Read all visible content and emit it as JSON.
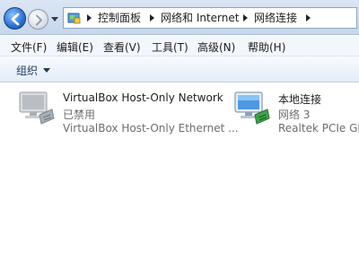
{
  "address_bar": {
    "breadcrumbs": [
      {
        "label": "控制面板"
      },
      {
        "label": "网络和 Internet"
      },
      {
        "label": "网络连接"
      }
    ]
  },
  "menu": {
    "items": [
      {
        "label": "文件(F)"
      },
      {
        "label": "编辑(E)"
      },
      {
        "label": "查看(V)"
      },
      {
        "label": "工具(T)"
      },
      {
        "label": "高级(N)"
      },
      {
        "label": "帮助(H)"
      }
    ]
  },
  "command_bar": {
    "organize_label": "组织"
  },
  "connections": [
    {
      "name": "VirtualBox Host-Only Network",
      "status": "已禁用",
      "device": "VirtualBox Host-Only Ethernet ...",
      "disabled": true
    },
    {
      "name": "本地连接",
      "status": "网络  3",
      "device": "Realtek PCIe GB",
      "disabled": false
    }
  ],
  "colors": {
    "address_bar_bg": "#c6d7ec",
    "link_text": "#1e395b",
    "secondary_text": "#6d6d6d"
  }
}
